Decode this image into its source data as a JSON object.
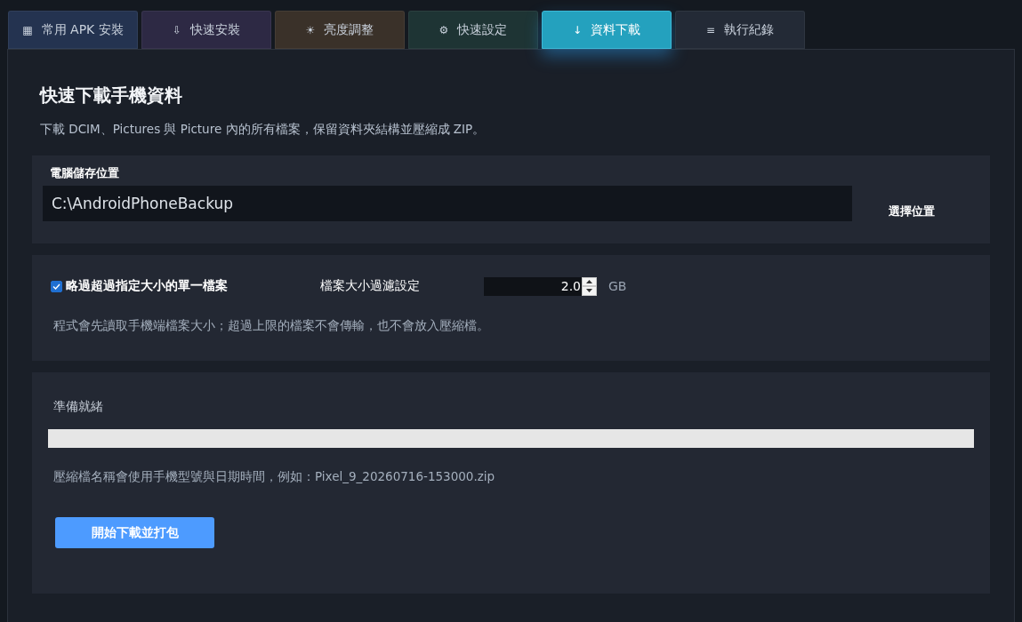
{
  "tabs": [
    {
      "icon": "▦",
      "label": "常用 APK 安裝",
      "color": "#243350",
      "selected": false
    },
    {
      "icon": "⇩",
      "label": "快速安裝",
      "color": "#2d2944",
      "selected": false
    },
    {
      "icon": "☀",
      "label": "亮度調整",
      "color": "#3a3129",
      "selected": false
    },
    {
      "icon": "⚙",
      "label": "快速設定",
      "color": "#1e3434",
      "selected": false
    },
    {
      "icon": "↓",
      "label": "資料下載",
      "color": "#24a1be",
      "selected": true
    },
    {
      "icon": "≡",
      "label": "執行紀錄",
      "color": "#232a36",
      "selected": false
    }
  ],
  "page": {
    "title": "快速下載手機資料",
    "description": "下載 DCIM、Pictures 與 Picture 內的所有檔案，保留資料夾結構並壓縮成 ZIP。"
  },
  "save_location": {
    "label": "電腦儲存位置",
    "value": "C:\\AndroidPhoneBackup",
    "button": "選擇位置"
  },
  "filter": {
    "skip_large": {
      "label": "略過超過指定大小的單一檔案",
      "checked": true
    },
    "size_label": "檔案大小過濾設定",
    "size_value": "2.0",
    "unit": "GB",
    "note": "程式會先讀取手機端檔案大小；超過上限的檔案不會傳輸，也不會放入壓縮檔。"
  },
  "progress": {
    "status": "準備就緒",
    "level": 0,
    "note": "壓縮檔名稱會使用手機型號與日期時間，例如：Pixel_9_20260716-153000.zip",
    "button": "開始下載並打包"
  }
}
